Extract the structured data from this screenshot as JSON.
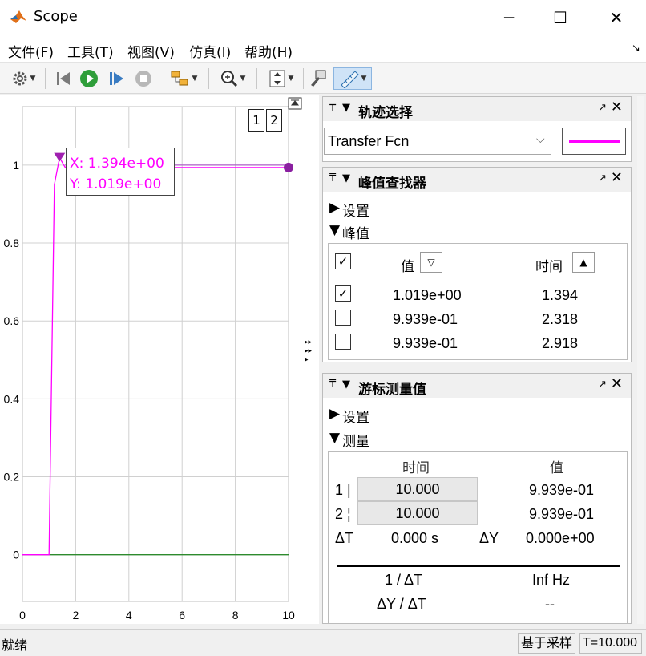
{
  "window": {
    "title": "Scope",
    "minimize": "─",
    "maximize": "☐",
    "close": "✕"
  },
  "menu": [
    "文件(F)",
    "工具(T)",
    "视图(V)",
    "仿真(I)",
    "帮助(H)"
  ],
  "menu_pin": "↘",
  "toolbar": {
    "icons": [
      "gear-icon",
      "step-back-icon",
      "run-icon",
      "step-forward-icon",
      "stop-icon",
      "signal-select-icon",
      "zoom-icon",
      "autoscale-icon",
      "highlight-block-icon",
      "measure-icon"
    ]
  },
  "plot": {
    "y_ticks": [
      "1",
      "0.8",
      "0.6",
      "0.4",
      "0.2",
      "0"
    ],
    "x_ticks": [
      "0",
      "2",
      "4",
      "6",
      "8",
      "10"
    ],
    "legend_buttons": [
      "1",
      "2"
    ],
    "tooltip": {
      "x_line": "X:  1.394e+00",
      "y_line": "Y:  1.019e+00"
    },
    "expand_arrows": "▸▸▸▸▸"
  },
  "chart_data": {
    "type": "line",
    "xlim": [
      0,
      10
    ],
    "ylim": [
      -0.12,
      1.15
    ],
    "grid": true,
    "series": [
      {
        "color": "#ff00ff",
        "x": [
          0,
          1.0,
          1.2,
          1.394,
          1.6,
          2.318,
          2.918,
          10
        ],
        "y": [
          0,
          0,
          0.95,
          1.019,
          0.995,
          0.9939,
          0.9939,
          0.9939
        ]
      },
      {
        "color": "#2e8b2e",
        "x": [
          0,
          10
        ],
        "y": [
          0,
          0
        ]
      }
    ],
    "peak_marker": {
      "x": 1.394,
      "y": 1.019
    },
    "cursor_marker": {
      "x": 10,
      "y": 0.9939
    }
  },
  "trace_panel": {
    "title": "轨迹选择",
    "selected": "Transfer Fcn",
    "line_color": "#ff00ff"
  },
  "peak_panel": {
    "title": "峰值查找器",
    "settings": "设置",
    "peaks": "峰值",
    "col_value": "值",
    "col_time": "时间",
    "rows": [
      {
        "checked": true,
        "value": "1.019e+00",
        "time": "1.394"
      },
      {
        "checked": false,
        "value": "9.939e-01",
        "time": "2.318"
      },
      {
        "checked": false,
        "value": "9.939e-01",
        "time": "2.918"
      }
    ]
  },
  "cursor_panel": {
    "title": "游标测量值",
    "settings": "设置",
    "measure": "测量",
    "col_time": "时间",
    "col_value": "值",
    "c1_label": "1 |",
    "c1_time": "10.000",
    "c1_value": "9.939e-01",
    "c2_label": "2 ¦",
    "c2_time": "10.000",
    "c2_value": "9.939e-01",
    "dt_label": "ΔT",
    "dt_value": "0.000 s",
    "dy_label": "ΔY",
    "dy_value": "0.000e+00",
    "inv_dt_label": "1 / ΔT",
    "inv_dt_value": "Inf Hz",
    "dydt_label": "ΔY / ΔT",
    "dydt_value": "--"
  },
  "status": {
    "left": "就绪",
    "mode": "基于采样",
    "time": "T=10.000"
  }
}
